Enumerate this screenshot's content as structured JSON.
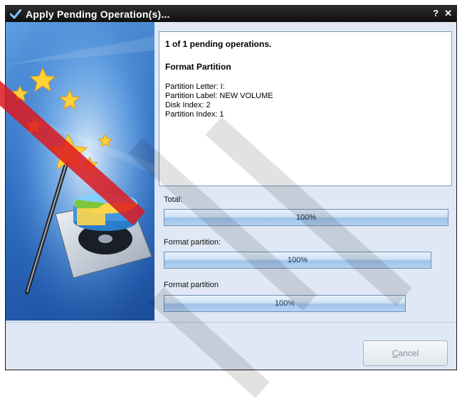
{
  "window": {
    "title": "Apply Pending Operation(s)...",
    "help_icon": "?",
    "close_icon": "✕"
  },
  "panel": {
    "summary": "1 of 1 pending operations.",
    "operation_name": "Format Partition",
    "details": [
      "Partition Letter: I:",
      "Partition Label: NEW VOLUME",
      "Disk Index: 2",
      "Partition Index: 1"
    ]
  },
  "progress": [
    {
      "label": "Total:",
      "value_text": "100%",
      "value": 1.0
    },
    {
      "label": "Format partition:",
      "value_text": "100%",
      "value": 1.0
    },
    {
      "label": "Format partition",
      "value_text": "100%",
      "value": 1.0
    }
  ],
  "buttons": {
    "cancel_label": "Cancel",
    "cancel_accesskey": "C"
  },
  "colors": {
    "titlebar": "#111111",
    "dialog_bg": "#dfe8f4",
    "progress_fill": "#a9c9ec",
    "watermark_red": "#dc191e"
  },
  "icons": {
    "title_icon": "check-icon",
    "side_image": "magic-wand-disk-illustration"
  }
}
